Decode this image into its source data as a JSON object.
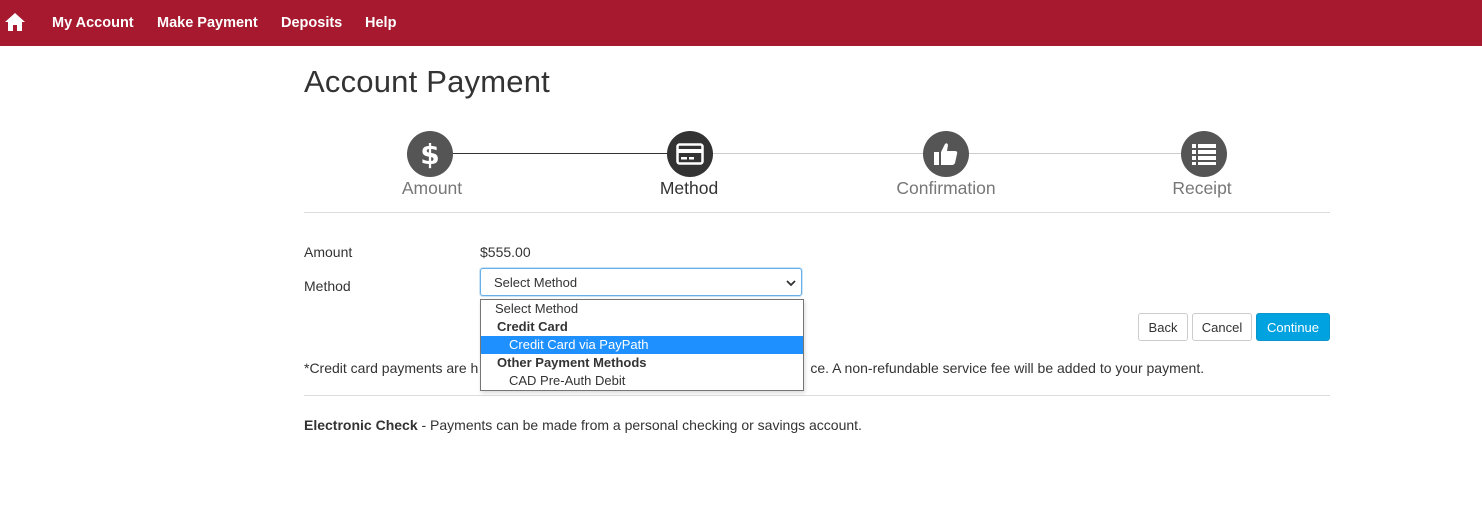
{
  "nav": {
    "items": [
      "My Account",
      "Make Payment",
      "Deposits",
      "Help"
    ]
  },
  "page": {
    "title": "Account Payment"
  },
  "steps": [
    {
      "label": "Amount",
      "icon": "dollar-icon"
    },
    {
      "label": "Method",
      "icon": "credit-card-icon"
    },
    {
      "label": "Confirmation",
      "icon": "thumbs-up-icon"
    },
    {
      "label": "Receipt",
      "icon": "list-icon"
    }
  ],
  "form": {
    "amount_label": "Amount",
    "amount_value": "$555.00",
    "method_label": "Method",
    "method_selected": "Select Method"
  },
  "dropdown": {
    "placeholder": "Select Method",
    "group1": "Credit Card",
    "group1_option1": "Credit Card via PayPath",
    "group2": "Other Payment Methods",
    "group2_option1": "CAD Pre-Auth Debit"
  },
  "buttons": {
    "back": "Back",
    "cancel": "Cancel",
    "continue": "Continue"
  },
  "notes": {
    "credit_card_prefix": "*Credit card payments are h",
    "credit_card_suffix": "ce. A non-refundable service fee will be added to your payment.",
    "echeck_title": "Electronic Check",
    "echeck_text": " - Payments can be made from a personal checking or savings account."
  },
  "colors": {
    "brand": "#a6192e",
    "primary_button": "#00a2e0",
    "selected_option": "#1e90ff"
  }
}
